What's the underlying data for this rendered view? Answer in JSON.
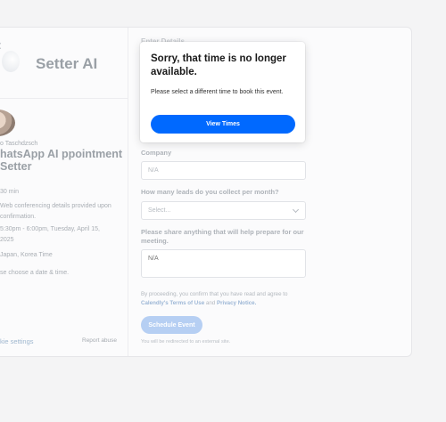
{
  "left": {
    "brand": "Setter AI",
    "host": "o Taschdzsch",
    "event_title": "hatsApp AI ppointment Setter",
    "duration": "30 min",
    "conference": "Web conferencing details provided upon confirmation.",
    "datetime": "5:30pm - 6:00pm, Tuesday, April 15, 2025",
    "timezone": "Japan, Korea Time",
    "hint": "se choose a date & time.",
    "cookie": "kie settings",
    "report": "Report abuse"
  },
  "form": {
    "section_title": "Enter Details",
    "company_label": "Company",
    "company_placeholder": "N/A",
    "leads_label": "How many leads do you collect per month?",
    "leads_value": "Select...",
    "prepare_label": "Please share anything that will help prepare for our meeting.",
    "prepare_placeholder": "N/A",
    "consent_pre": "By proceeding, you confirm that you have read and agree to",
    "consent_link1": "Calendly's Terms of Use",
    "consent_and": "and",
    "consent_link2": "Privacy Notice.",
    "schedule_label": "Schedule Event",
    "redirect_note": "You will be redirected to an external site."
  },
  "modal": {
    "title": "Sorry, that time is no longer available.",
    "message": "Please select a different time to book this event.",
    "button": "View Times"
  },
  "colors": {
    "primary": "#0069ff",
    "faded_primary": "#b6cff3"
  }
}
